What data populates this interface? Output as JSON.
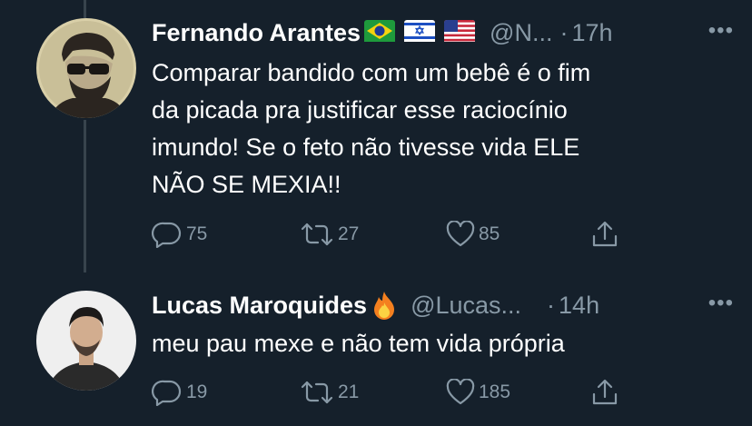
{
  "tweets": [
    {
      "display_name": "Fernando Arantes",
      "flags": [
        "brazil-flag",
        "israel-flag",
        "usa-flag"
      ],
      "handle": "@N...",
      "dot": "·",
      "time": "17h",
      "more": "•••",
      "text_lines": [
        "Comparar bandido com um bebê é o fim",
        "da picada pra justificar esse raciocínio",
        "imundo! Se o feto não tivesse vida ELE",
        "NÃO SE MEXIA!!"
      ],
      "replies": "75",
      "retweets": "27",
      "likes": "85"
    },
    {
      "display_name": "Lucas Maroquides",
      "emoji": "🔥",
      "handle": "@Lucas...",
      "dot": "·",
      "time": "14h",
      "more": "•••",
      "text_lines": [
        "meu pau mexe e não tem vida própria"
      ],
      "replies": "19",
      "retweets": "21",
      "likes": "185"
    }
  ],
  "colors": {
    "background": "#15202b",
    "secondary_text": "#8899a6",
    "thread_line": "#38444d",
    "primary_text": "#ffffff"
  }
}
